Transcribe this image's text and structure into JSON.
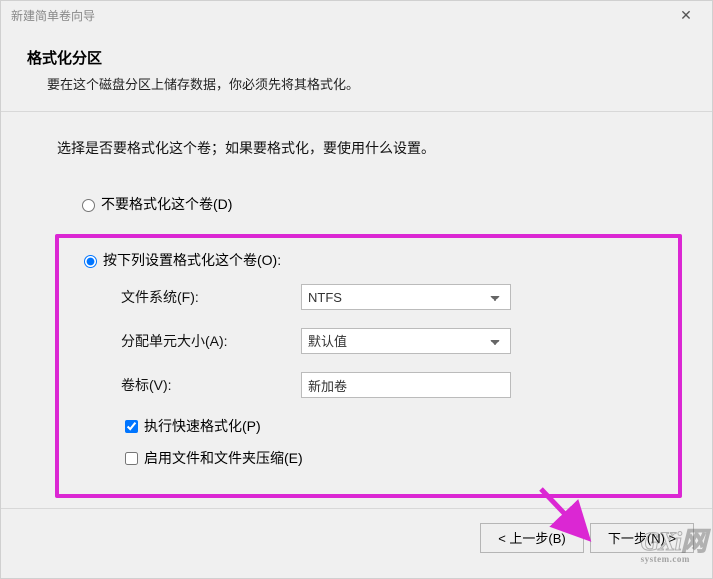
{
  "window": {
    "title": "新建简单卷向导"
  },
  "header": {
    "title": "格式化分区",
    "subtitle": "要在这个磁盘分区上储存数据，你必须先将其格式化。"
  },
  "instruction": "选择是否要格式化这个卷；如果要格式化，要使用什么设置。",
  "options": {
    "noformat_label": "不要格式化这个卷(D)",
    "format_label": "按下列设置格式化这个卷(O):"
  },
  "fields": {
    "filesystem": {
      "label": "文件系统(F):",
      "value": "NTFS"
    },
    "allocation": {
      "label": "分配单元大小(A):",
      "value": "默认值"
    },
    "volumelabel": {
      "label": "卷标(V):",
      "value": "新加卷"
    }
  },
  "checks": {
    "quickformat": "执行快速格式化(P)",
    "compression": "启用文件和文件夹压缩(E)"
  },
  "buttons": {
    "back": "< 上一步(B)",
    "next": "下一步(N) >"
  },
  "watermark": {
    "main": "GXi网",
    "sub": "system.com"
  },
  "annotation_color": "#db27d3"
}
